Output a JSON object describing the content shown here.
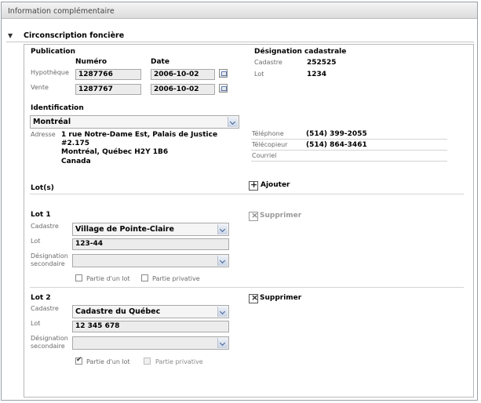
{
  "panel": {
    "title": "Information complémentaire"
  },
  "section": {
    "title": "Circonscription foncière"
  },
  "publication": {
    "heading": "Publication",
    "col_numero": "Numéro",
    "col_date": "Date",
    "rows": [
      {
        "label": "Hypothèque",
        "numero": "1287766",
        "date": "2006-10-02"
      },
      {
        "label": "Vente",
        "numero": "1287767",
        "date": "2006-10-02"
      }
    ]
  },
  "designation": {
    "heading": "Désignation cadastrale",
    "cadastre_label": "Cadastre",
    "cadastre_value": "252525",
    "lot_label": "Lot",
    "lot_value": "1234"
  },
  "identification": {
    "heading": "Identification",
    "selected": "Montréal",
    "adresse_label": "Adresse",
    "adresse_lines": [
      "1 rue Notre-Dame Est, Palais de Justice",
      "#2.175",
      "Montréal, Québec H2Y 1B6",
      "Canada"
    ],
    "telephone_label": "Téléphone",
    "telephone_value": "(514) 399-2055",
    "telecopieur_label": "Télécopieur",
    "telecopieur_value": "(514) 864-3461",
    "courriel_label": "Courriel",
    "courriel_value": ""
  },
  "lots": {
    "heading": "Lot(s)",
    "add_label": "Ajouter",
    "items": [
      {
        "title": "Lot 1",
        "delete_label": "Supprimer",
        "cadastre_label": "Cadastre",
        "cadastre_value": "Village de Pointe-Claire",
        "lot_label": "Lot",
        "lot_value": "123-44",
        "desig_label_1": "Désignation",
        "desig_label_2": "secondaire",
        "desig_value": "",
        "partie_lot_label": "Partie d'un lot",
        "partie_lot_checked": false,
        "partie_privative_label": "Partie privative",
        "partie_privative_checked": false
      },
      {
        "title": "Lot 2",
        "delete_label": "Supprimer",
        "cadastre_label": "Cadastre",
        "cadastre_value": "Cadastre du Québec",
        "lot_label": "Lot",
        "lot_value": "12 345 678",
        "desig_label_1": "Désignation",
        "desig_label_2": "secondaire",
        "desig_value": "",
        "partie_lot_label": "Partie d'un lot",
        "partie_lot_checked": true,
        "partie_privative_label": "Partie privative",
        "partie_privative_checked": false
      }
    ]
  }
}
